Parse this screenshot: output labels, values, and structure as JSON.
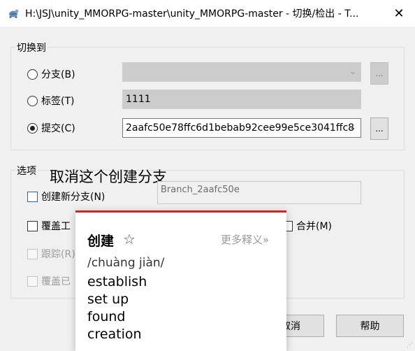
{
  "window": {
    "title": "H:\\JSJ\\unity_MMORPG-master\\unity_MMORPG-master - 切换/检出 - T...",
    "close_label": "✕"
  },
  "switch_to": {
    "title": "切换到",
    "branch": {
      "label": "分支(B)",
      "value": "",
      "selected": false
    },
    "tag": {
      "label": "标签(T)",
      "value": "1111",
      "selected": false
    },
    "commit": {
      "label": "提交(C)",
      "value": "2aafc50e78ffc6d1bebab92cee99e5ce3041ffc8",
      "selected": true
    },
    "browse_label": "..."
  },
  "options": {
    "title": "选项",
    "create_branch": {
      "label": "创建新分支(N)",
      "checked": false
    },
    "branch_name": {
      "value": "Branch_2aafc50e"
    },
    "overwrite": {
      "label": "覆盖工",
      "checked": false
    },
    "merge": {
      "label": "合并(M)",
      "checked": false
    },
    "track": {
      "label": "跟踪(R)",
      "checked": false
    },
    "overwrite_existing": {
      "label": "覆盖已",
      "checked": false
    }
  },
  "overlay_caption": "取消这个创建分支",
  "buttons": {
    "cancel": "取消",
    "help": "帮助"
  },
  "dictionary_popup": {
    "word": "创建",
    "favorite_icon": "☆",
    "more_link": "更多释义»",
    "pronunciation": "/chuàng jiàn/",
    "definitions": [
      "establish",
      "set up",
      "found",
      "creation"
    ],
    "accent_color": "#c62828"
  },
  "icons": {
    "app": "tortoisegit-icon",
    "dropdown": "⌄",
    "grip": "⋰"
  }
}
